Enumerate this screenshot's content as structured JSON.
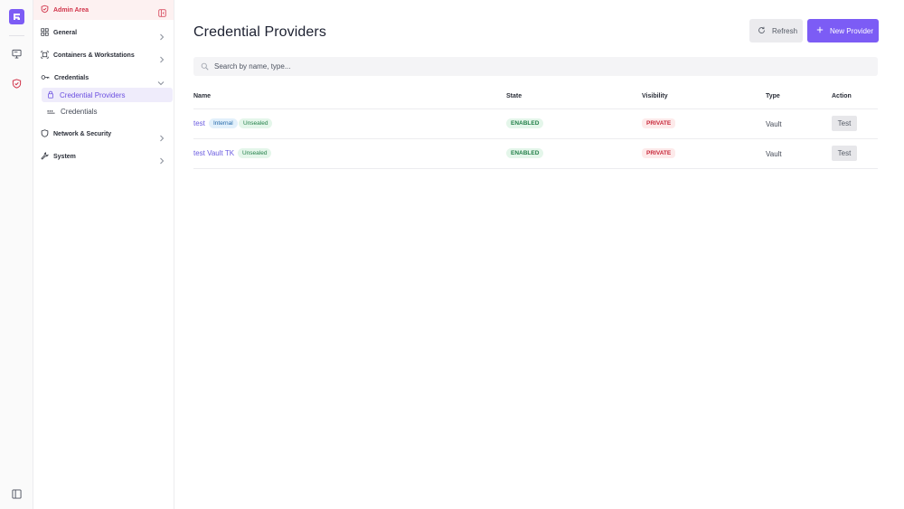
{
  "rail": {
    "icons": [
      "app-logo-icon",
      "monitor-icon",
      "shield-icon",
      "panel-toggle-icon"
    ],
    "accent": "#7c5cf5",
    "active_color": "#d1344a"
  },
  "sidebar": {
    "header_label": "Admin Area",
    "items": [
      {
        "label": "General",
        "icon": "grid-icon"
      },
      {
        "label": "Containers & Workstations",
        "icon": "containers-icon"
      },
      {
        "label": "Credentials",
        "icon": "key-icon",
        "expanded": true
      },
      {
        "label": "Network & Security",
        "icon": "shield-outline-icon"
      },
      {
        "label": "System",
        "icon": "wrench-icon"
      }
    ],
    "sub_items": [
      {
        "label": "Credential Providers",
        "icon": "lock-icon",
        "active": true
      },
      {
        "label": "Credentials",
        "icon": "dots-icon",
        "active": false
      }
    ]
  },
  "main": {
    "title": "Credential Providers",
    "refresh_label": "Refresh",
    "new_provider_label": "New Provider",
    "search_placeholder": "Search by name, type...",
    "columns": [
      "Name",
      "State",
      "Visibility",
      "Type",
      "Action"
    ],
    "rows": [
      {
        "name": "test",
        "tags": [
          "Internal",
          "Unsealed"
        ],
        "state": "ENABLED",
        "visibility": "PRIVATE",
        "type": "Vault",
        "action": "Test"
      },
      {
        "name": "test Vault TK",
        "tags": [
          "Unsealed"
        ],
        "state": "ENABLED",
        "visibility": "PRIVATE",
        "type": "Vault",
        "action": "Test"
      }
    ]
  }
}
